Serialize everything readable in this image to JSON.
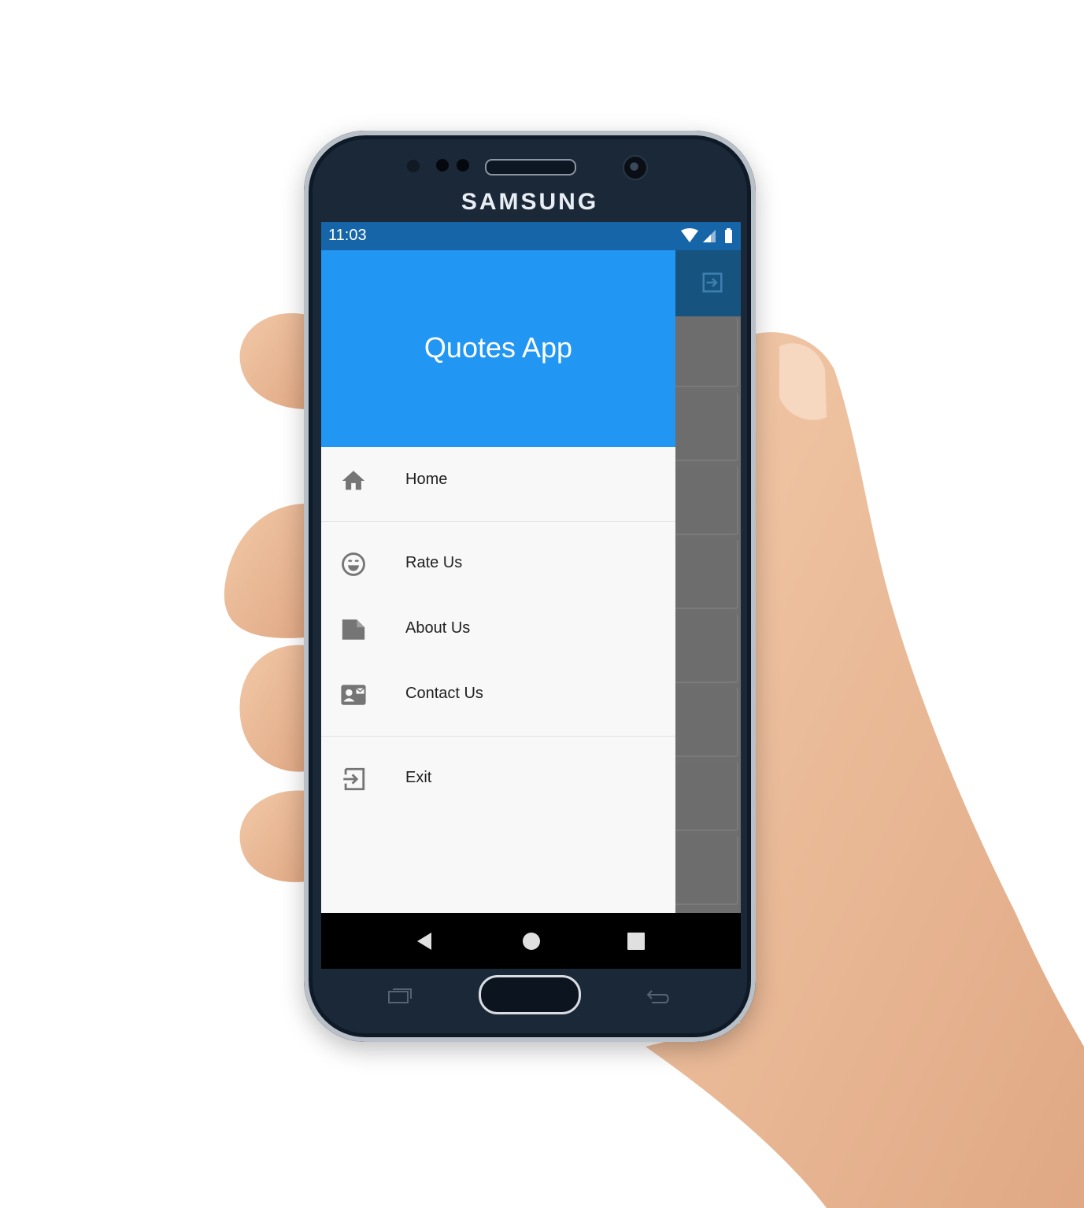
{
  "device": {
    "brand": "SAMSUNG"
  },
  "status_bar": {
    "time": "11:03"
  },
  "drawer": {
    "title": "Quotes App",
    "items": [
      {
        "label": "Home",
        "icon": "home-icon"
      },
      {
        "label": "Rate Us",
        "icon": "smiley-icon"
      },
      {
        "label": "About Us",
        "icon": "note-icon"
      },
      {
        "label": "Contact Us",
        "icon": "contact-card-icon"
      },
      {
        "label": "Exit",
        "icon": "exit-icon"
      }
    ]
  },
  "colors": {
    "header": "#2196f3",
    "status_bar": "#1565a8",
    "app_bar": "#16537f",
    "scrim": "#6e6e6e",
    "drawer_bg": "#f8f8f8",
    "icon": "#757575"
  }
}
